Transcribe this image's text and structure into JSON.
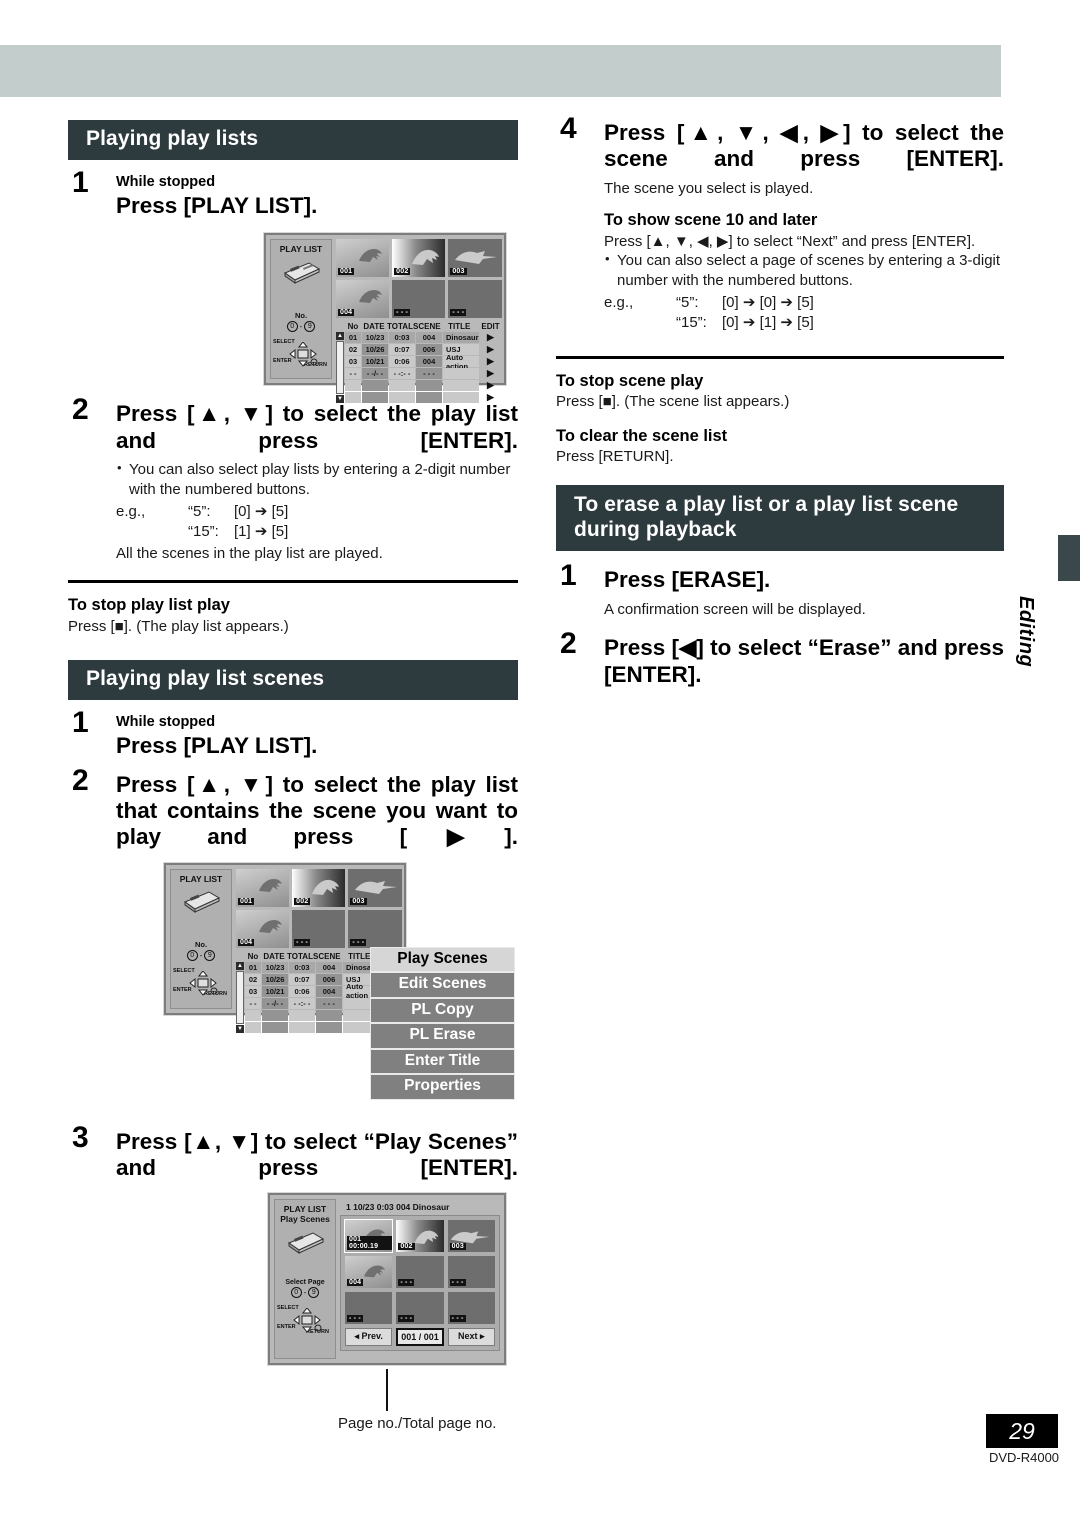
{
  "page": {
    "number": "29",
    "model": "DVD-R4000",
    "side_tab_label": "Editing"
  },
  "left": {
    "section1": {
      "heading": "Playing play lists",
      "steps": [
        {
          "num": "1",
          "pre": "While stopped",
          "title": "Press [PLAY LIST]."
        },
        {
          "num": "2",
          "title": "Press [▲, ▼] to select the play list and press [ENTER]."
        }
      ],
      "bullet": "You can also select play lists by entering a 2-digit number with the numbered buttons.",
      "eg_label": "e.g.,",
      "eg_rows": [
        {
          "quoted": "“5”:",
          "keys": "[0] ➔ [5]"
        },
        {
          "quoted": "“15”:",
          "keys": "[1] ➔ [5]"
        }
      ],
      "note": "All the scenes in the play list are played.",
      "stop_title": "To stop play list play",
      "stop_text": "Press [■]. (The play list appears.)"
    },
    "section2": {
      "heading": "Playing play list scenes",
      "steps": [
        {
          "num": "1",
          "pre": "While stopped",
          "title": "Press [PLAY LIST]."
        },
        {
          "num": "2",
          "title": "Press [▲, ▼] to select the play list that contains the scene you want to play and press [▶]."
        },
        {
          "num": "3",
          "title": "Press [▲, ▼] to select “Play Scenes” and press [ENTER]."
        }
      ],
      "caption": "Page no./Total page no."
    }
  },
  "right": {
    "step4": {
      "num": "4",
      "title": "Press [▲, ▼, ◀, ▶] to select the scene and press [ENTER].",
      "note": "The scene you select is played.",
      "sub_title": "To show scene 10 and later",
      "sub_line": "Press [▲, ▼, ◀, ▶] to select “Next” and press [ENTER].",
      "bullet": "You can also select a page of scenes by entering a 3-digit number with the numbered buttons.",
      "eg_label": "e.g.,",
      "eg_rows": [
        {
          "quoted": "“5”:",
          "keys": "[0] ➔ [0] ➔ [5]"
        },
        {
          "quoted": "“15”:",
          "keys": "[0] ➔ [1] ➔ [5]"
        }
      ]
    },
    "stop_scene": {
      "title": "To stop scene play",
      "text": "Press [■]. (The scene list appears.)"
    },
    "clear_scene": {
      "title": "To clear the scene list",
      "text": "Press [RETURN]."
    },
    "erase_heading": "To erase a play list or a play list scene during playback",
    "erase_steps": [
      {
        "num": "1",
        "title": "Press [ERASE].",
        "note": "A confirmation screen will be displayed."
      },
      {
        "num": "2",
        "title": "Press [◀] to select “Erase” and press [ENTER]."
      }
    ]
  },
  "figures": {
    "play_list_screen": {
      "side_title": "PLAY LIST",
      "side_no_label": "No.",
      "range_from": "0",
      "range_to": "9",
      "pad_select": "SELECT",
      "pad_enter": "ENTER",
      "pad_return": "RETURN",
      "thumbs": [
        {
          "tag": "001"
        },
        {
          "tag": "002"
        },
        {
          "tag": "003"
        },
        {
          "tag": "004"
        },
        {
          "tag": "- - -"
        },
        {
          "tag": "- - -"
        }
      ],
      "columns": [
        "No",
        "DATE",
        "TOTAL",
        "SCENE",
        "TITLE",
        "EDIT"
      ],
      "rows": [
        {
          "no": "01",
          "date": "10/23",
          "total": "0:03",
          "scene": "004",
          "title": "Dinosaur"
        },
        {
          "no": "02",
          "date": "10/26",
          "total": "0:07",
          "scene": "006",
          "title": "USJ"
        },
        {
          "no": "03",
          "date": "10/21",
          "total": "0:06",
          "scene": "004",
          "title": "Auto action"
        },
        {
          "no": "- -",
          "date": "- -/- -",
          "total": "- -:- -",
          "scene": "- - -",
          "title": ""
        },
        {
          "no": "",
          "date": "",
          "total": "",
          "scene": "",
          "title": ""
        },
        {
          "no": "",
          "date": "",
          "total": "",
          "scene": "",
          "title": ""
        }
      ]
    },
    "menu": {
      "items": [
        "Play Scenes",
        "Edit Scenes",
        "PL Copy",
        "PL Erase",
        "Enter Title",
        "Properties"
      ],
      "selected": "Play Scenes"
    },
    "scene_screen": {
      "side_title_1": "PLAY LIST",
      "side_title_2": "Play Scenes",
      "header": "1 10/23 0:03 004     Dinosaur",
      "select_page_label": "Select Page",
      "range_from": "0",
      "range_to": "9",
      "pad_select": "SELECT",
      "pad_enter": "ENTER",
      "pad_return": "RETURN",
      "thumbs": [
        {
          "tag": "001  00:00.19"
        },
        {
          "tag": "002"
        },
        {
          "tag": "003"
        },
        {
          "tag": "004"
        },
        {
          "tag": "- - -"
        },
        {
          "tag": "- - -"
        },
        {
          "tag": "- - -"
        },
        {
          "tag": "- - -"
        },
        {
          "tag": "- - -"
        }
      ],
      "prev_label": "◂ Prev.",
      "page_label": "001 / 001",
      "next_label": "Next ▸"
    }
  },
  "colors": {
    "band": "#c3cdcb",
    "heading_bar": "#2e3b3e",
    "tab": "#3a484b"
  }
}
